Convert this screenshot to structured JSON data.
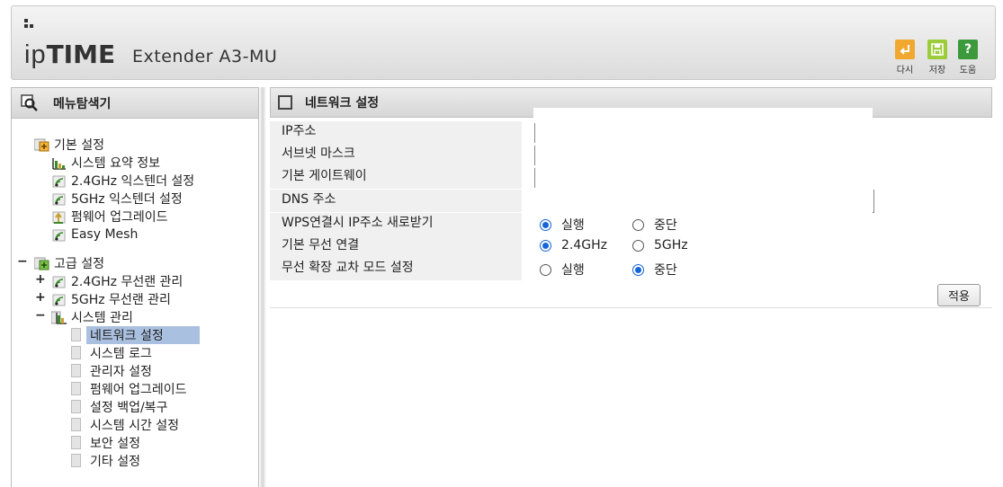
{
  "header": {
    "brand_light": "ip",
    "brand_bold": "TIME",
    "model": "Extender A3-MU",
    "tools": [
      {
        "label": "다시",
        "icon": "undo-icon",
        "color": "#f0a830"
      },
      {
        "label": "저장",
        "icon": "save-icon",
        "color": "#9ccc3c"
      },
      {
        "label": "도움",
        "icon": "help-icon",
        "color": "#3c9a3c"
      }
    ]
  },
  "sidebar": {
    "title": "메뉴탐색기",
    "groups": [
      {
        "label": "기본 설정",
        "expander": "",
        "items": [
          {
            "label": "시스템 요약 정보",
            "icon": "bar-chart-icon"
          },
          {
            "label": "2.4GHz 익스텐더 설정",
            "icon": "wifi-icon"
          },
          {
            "label": "5GHz 익스텐더 설정",
            "icon": "wifi-icon"
          },
          {
            "label": "펌웨어 업그레이드",
            "icon": "upgrade-icon"
          },
          {
            "label": "Easy Mesh",
            "icon": "wifi-icon"
          }
        ]
      },
      {
        "label": "고급 설정",
        "expander": "−",
        "items": [
          {
            "label": "2.4GHz 무선랜 관리",
            "expander": "+",
            "icon": "wifi-icon"
          },
          {
            "label": "5GHz 무선랜 관리",
            "expander": "+",
            "icon": "wifi-icon"
          },
          {
            "label": "시스템 관리",
            "expander": "−",
            "icon": "bar-chart-icon"
          }
        ]
      }
    ],
    "system_items": [
      "네트워크 설정",
      "시스템 로그",
      "관리자 설정",
      "펌웨어 업그레이드",
      "설정 백업/복구",
      "시스템 시간 설정",
      "보안 설정",
      "기타 설정"
    ],
    "selected": "네트워크 설정"
  },
  "main": {
    "title": "네트워크 설정",
    "fields": {
      "ip_label": "IP주소",
      "subnet_label": "서브넷 마스크",
      "gateway_label": "기본 게이트웨이",
      "dns_label": "DNS 주소",
      "wps_label": "WPS연결시 IP주소 새로받기",
      "wireless_label": "기본 무선 연결",
      "cross_label": "무선 확장 교차 모드 설정"
    },
    "wps": {
      "options": [
        "실행",
        "중단"
      ],
      "selected": "실행"
    },
    "wireless": {
      "options": [
        "2.4GHz",
        "5GHz"
      ],
      "selected": "2.4GHz"
    },
    "cross": {
      "options": [
        "실행",
        "중단"
      ],
      "selected": "중단"
    },
    "apply_label": "적용"
  }
}
